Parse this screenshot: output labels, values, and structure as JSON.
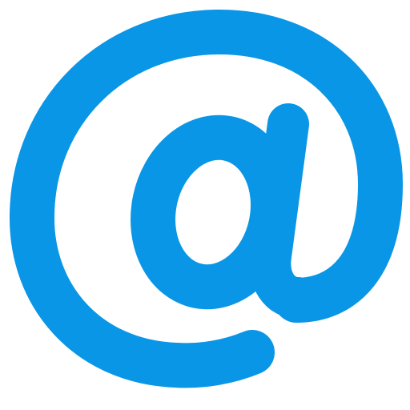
{
  "icon": {
    "name": "at-sign-icon",
    "color": "#0A96E6",
    "background": "#FFFFFF"
  }
}
